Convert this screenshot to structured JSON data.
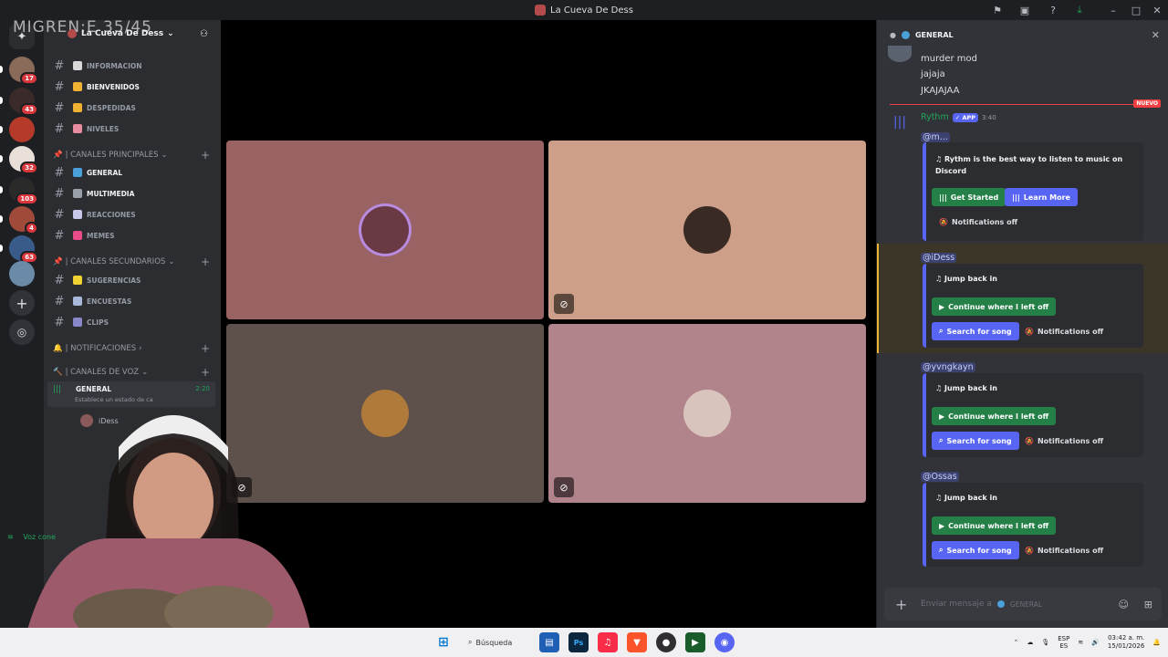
{
  "window": {
    "title": "La Cueva De Dess"
  },
  "overlay_text": "MIGREN:E  35/45",
  "servers": [
    {
      "badge": "17",
      "color": "#8a6b5a"
    },
    {
      "badge": "43",
      "color": "#3a2a2a"
    },
    {
      "badge": "",
      "color": "#b53a2a"
    },
    {
      "badge": "32",
      "color": "#e8e0d8"
    },
    {
      "badge": "103",
      "color": "#2a2a2a"
    },
    {
      "badge": "4",
      "color": "#a04a3a"
    },
    {
      "badge": "63",
      "color": "#3a5a8a"
    },
    {
      "badge": "",
      "color": "#6a8aa8"
    }
  ],
  "guild": {
    "name": "La Cueva De Dess"
  },
  "channels": {
    "top": [
      {
        "name": "INFORMACION",
        "bright": false
      },
      {
        "name": "BIENVENIDOS",
        "bright": true
      },
      {
        "name": "DESPEDIDAS",
        "bright": false
      },
      {
        "name": "NIVELES",
        "bright": false
      }
    ],
    "cat_principales": "| CANALES PRINCIPALES",
    "principales": [
      {
        "name": "GENERAL",
        "bright": true
      },
      {
        "name": "MULTIMEDIA",
        "bright": true
      },
      {
        "name": "REACCIONES",
        "bright": false
      },
      {
        "name": "MEMES",
        "bright": false
      }
    ],
    "cat_secundarios": "| CANALES SECUNDARIOS",
    "secundarios": [
      {
        "name": "SUGERENCIAS"
      },
      {
        "name": "ENCUESTAS"
      },
      {
        "name": "CLIPS"
      }
    ],
    "cat_notificaciones": "| NOTIFICACIONES",
    "cat_voz": "| CANALES DE VOZ",
    "voice_channel": {
      "name": "GENERAL",
      "time": "2:20",
      "status": "Establece un estado de ca"
    },
    "voice_user": "iDess",
    "voice_connected": "Voz cone"
  },
  "chat": {
    "channel": "GENERAL",
    "lines": [
      "murder mod",
      "jajaja",
      "JKAJAJAA"
    ],
    "new_label": "NUEVO",
    "bot": {
      "name": "Rythm",
      "tag": "APP",
      "time": "3:40",
      "mention": "@m..."
    },
    "embed1": {
      "title": "Rythm is the best way to listen to music on Discord",
      "btn1": "Get Started",
      "btn2": "Learn More",
      "btn3": "Notifications off"
    },
    "mentions": [
      "@iDess",
      "@yvngkayn",
      "@Ossas"
    ],
    "jump": {
      "title": "Jump back in",
      "continue": "Continue where I left off",
      "search": "Search for song",
      "notif": "Notifications off"
    },
    "composer": "Enviar mensaje a",
    "composer_channel": "GENERAL"
  },
  "taskbar": {
    "search": "Búsqueda",
    "lang1": "ESP",
    "lang2": "ES",
    "time": "03:42 a. m.",
    "date": "15/01/2026"
  },
  "colors": {
    "green": "#248046",
    "blurple": "#5865f2",
    "red": "#f23f43"
  }
}
